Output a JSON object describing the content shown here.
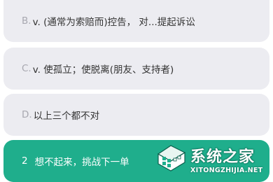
{
  "options": [
    {
      "letter": "B.",
      "text": "v. (通常为索赔而)控告， 对...提起诉讼"
    },
    {
      "letter": "C.",
      "text": "v. 使孤立；使脱离(朋友、支持者)"
    },
    {
      "letter": "D.",
      "text": "以上三个都不对"
    }
  ],
  "hint": {
    "number": "2",
    "label": "想不起来，挑战下一单"
  },
  "watermark": {
    "title": "系统之家",
    "url": "XITONGZHIJIA.NET"
  },
  "colors": {
    "option_bg": "#ececf1",
    "hint_bg": "#1fae8c",
    "letter": "#a8a8b0"
  }
}
